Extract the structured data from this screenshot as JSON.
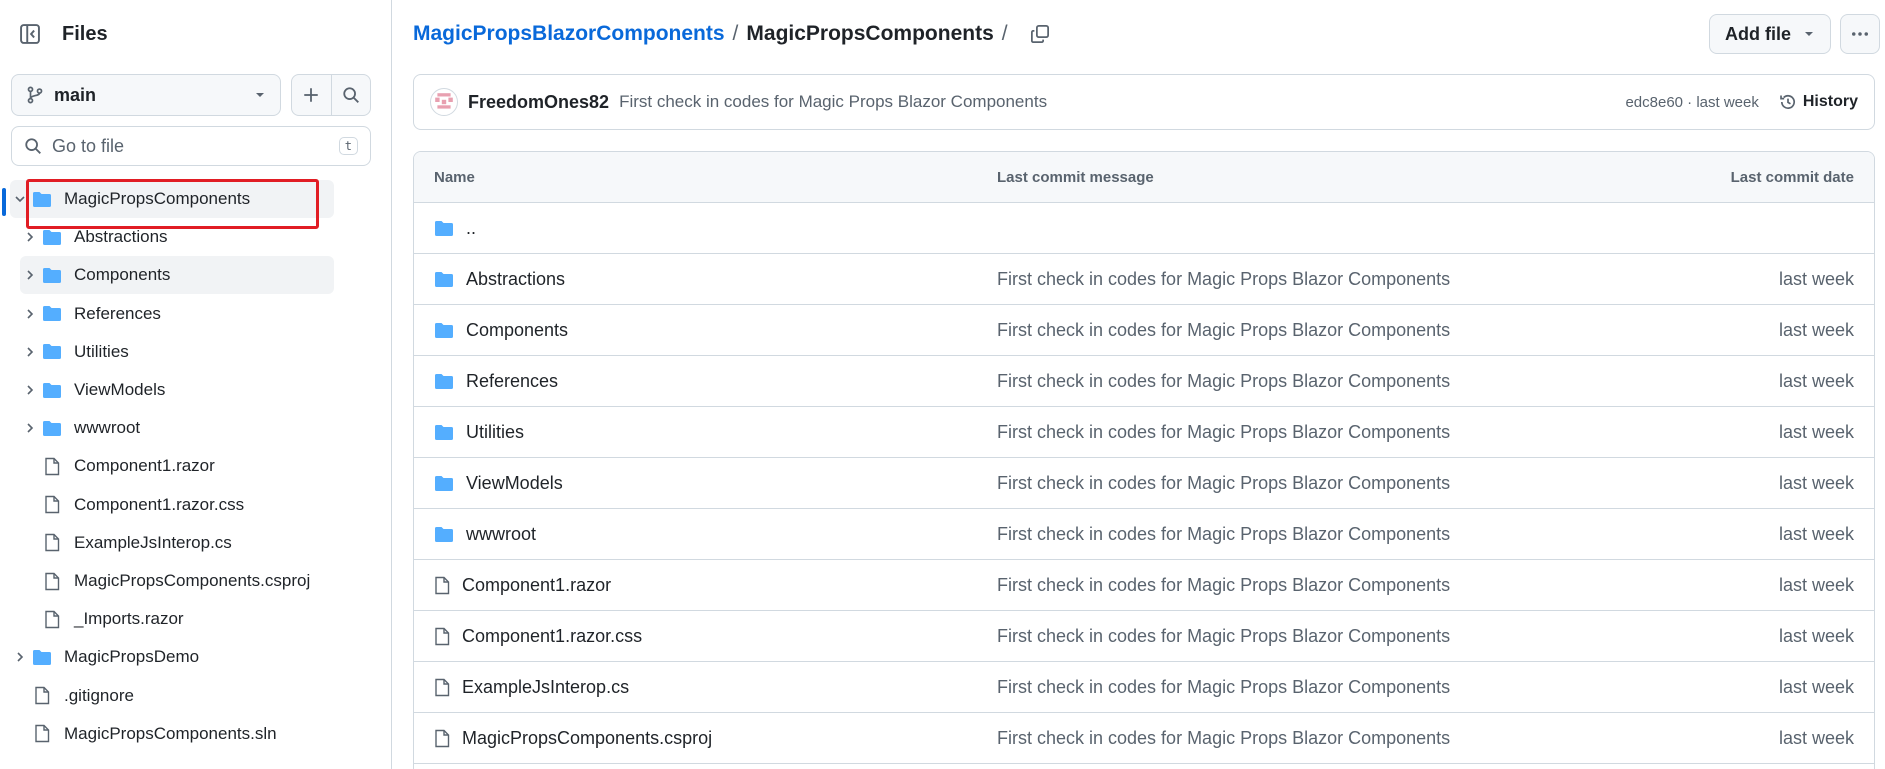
{
  "colors": {
    "accent": "#0969da",
    "folder": "#54aeff",
    "highlight_box": "#e11d24",
    "muted_text": "#59636e"
  },
  "sidebar": {
    "title": "Files",
    "branch": "main",
    "goto_placeholder": "Go to file",
    "goto_shortcut": "t",
    "tree": [
      {
        "label": "MagicPropsComponents",
        "type": "folder",
        "expanded": true,
        "level": 0
      },
      {
        "label": "Abstractions",
        "type": "folder",
        "expanded": false,
        "level": 1
      },
      {
        "label": "Components",
        "type": "folder",
        "expanded": false,
        "level": 1
      },
      {
        "label": "References",
        "type": "folder",
        "expanded": false,
        "level": 1
      },
      {
        "label": "Utilities",
        "type": "folder",
        "expanded": false,
        "level": 1
      },
      {
        "label": "ViewModels",
        "type": "folder",
        "expanded": false,
        "level": 1
      },
      {
        "label": "wwwroot",
        "type": "folder",
        "expanded": false,
        "level": 1
      },
      {
        "label": "Component1.razor",
        "type": "file",
        "level": 1
      },
      {
        "label": "Component1.razor.css",
        "type": "file",
        "level": 1
      },
      {
        "label": "ExampleJsInterop.cs",
        "type": "file",
        "level": 1
      },
      {
        "label": "MagicPropsComponents.csproj",
        "type": "file",
        "level": 1
      },
      {
        "label": "_Imports.razor",
        "type": "file",
        "level": 1
      },
      {
        "label": "MagicPropsDemo",
        "type": "folder",
        "expanded": false,
        "level": 0
      },
      {
        "label": ".gitignore",
        "type": "file",
        "level": 0
      },
      {
        "label": "MagicPropsComponents.sln",
        "type": "file",
        "level": 0
      }
    ]
  },
  "breadcrumb": {
    "repo": "MagicPropsBlazorComponents",
    "separator": "/",
    "current": "MagicPropsComponents"
  },
  "toolbar": {
    "add_file_label": "Add file"
  },
  "commit": {
    "author": "FreedomOnes82",
    "message": "First check in codes for Magic Props Blazor Components",
    "hash_time": "edc8e60 · last week",
    "history_label": "History"
  },
  "table": {
    "columns": [
      "Name",
      "Last commit message",
      "Last commit date"
    ],
    "parent_link": "..",
    "rows": [
      {
        "name": "Abstractions",
        "type": "folder",
        "message": "First check in codes for Magic Props Blazor Components",
        "date": "last week"
      },
      {
        "name": "Components",
        "type": "folder",
        "message": "First check in codes for Magic Props Blazor Components",
        "date": "last week"
      },
      {
        "name": "References",
        "type": "folder",
        "message": "First check in codes for Magic Props Blazor Components",
        "date": "last week"
      },
      {
        "name": "Utilities",
        "type": "folder",
        "message": "First check in codes for Magic Props Blazor Components",
        "date": "last week"
      },
      {
        "name": "ViewModels",
        "type": "folder",
        "message": "First check in codes for Magic Props Blazor Components",
        "date": "last week"
      },
      {
        "name": "wwwroot",
        "type": "folder",
        "message": "First check in codes for Magic Props Blazor Components",
        "date": "last week"
      },
      {
        "name": "Component1.razor",
        "type": "file",
        "message": "First check in codes for Magic Props Blazor Components",
        "date": "last week"
      },
      {
        "name": "Component1.razor.css",
        "type": "file",
        "message": "First check in codes for Magic Props Blazor Components",
        "date": "last week"
      },
      {
        "name": "ExampleJsInterop.cs",
        "type": "file",
        "message": "First check in codes for Magic Props Blazor Components",
        "date": "last week"
      },
      {
        "name": "MagicPropsComponents.csproj",
        "type": "file",
        "message": "First check in codes for Magic Props Blazor Components",
        "date": "last week"
      }
    ]
  }
}
